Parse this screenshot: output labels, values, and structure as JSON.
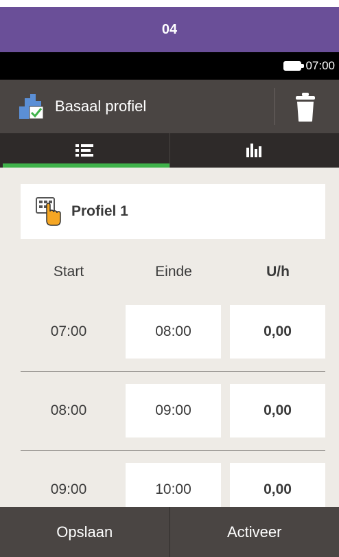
{
  "banner": {
    "title": "04"
  },
  "status": {
    "time": "07:00",
    "battery_icon": "battery-full-icon"
  },
  "header": {
    "title": "Basaal profiel",
    "icon": "basal-profile-check-icon",
    "delete_icon": "trash-icon"
  },
  "tabs": [
    {
      "icon": "list-icon",
      "active": true
    },
    {
      "icon": "bar-chart-icon",
      "active": false
    }
  ],
  "profile": {
    "name": "Profiel 1",
    "icon": "select-hand-icon"
  },
  "columns": {
    "start": "Start",
    "end": "Einde",
    "rate": "U/h"
  },
  "rows": [
    {
      "start": "07:00",
      "end": "08:00",
      "rate": "0,00"
    },
    {
      "start": "08:00",
      "end": "09:00",
      "rate": "0,00"
    },
    {
      "start": "09:00",
      "end": "10:00",
      "rate": "0,00"
    }
  ],
  "buttons": {
    "save": "Opslaan",
    "activate": "Activeer"
  },
  "colors": {
    "banner": "#6a4f98",
    "header": "#4a4543",
    "tab_bar": "#2e2a29",
    "active_tab": "#3fb24a",
    "content_bg": "#eeebe6"
  }
}
